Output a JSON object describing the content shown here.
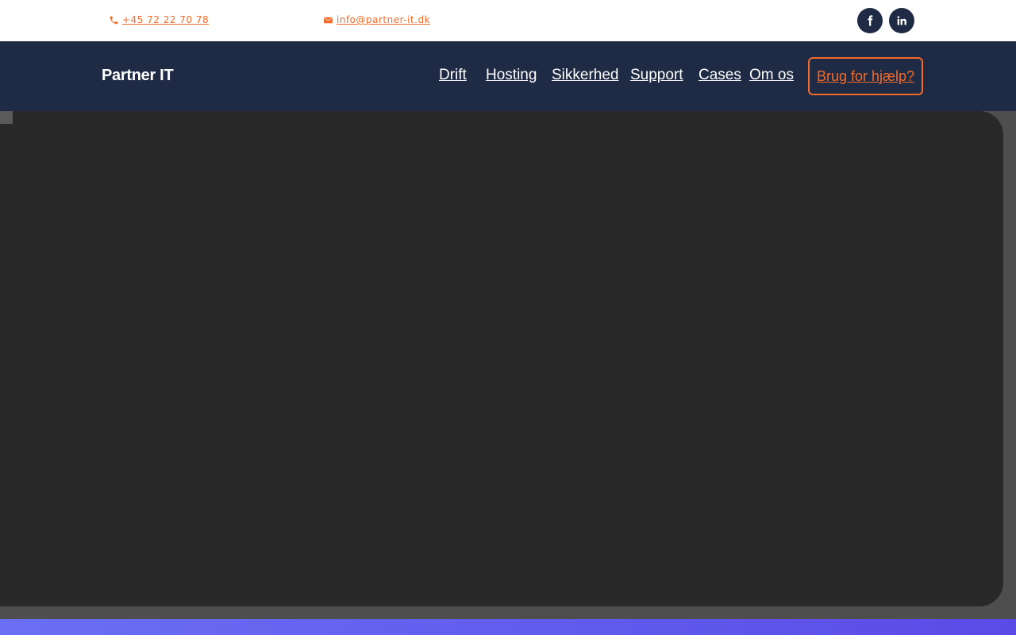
{
  "topbar": {
    "phone": "+45 72 22 70 78",
    "email": "info@partner-it.dk",
    "phone_icon": "phone-icon",
    "email_icon": "envelope-icon",
    "social": [
      {
        "icon": "facebook-icon",
        "glyph": "f"
      },
      {
        "icon": "linkedin-icon",
        "glyph": "in"
      }
    ]
  },
  "nav": {
    "logo": "Partner IT",
    "items": [
      "Drift",
      "Hosting",
      "Sikkerhed",
      "Support",
      "Cases",
      "Om os"
    ],
    "cta": "Brug for hjælp?"
  },
  "colors": {
    "navy": "#1f2a44",
    "accent": "#f26b2a",
    "hero": "#292929"
  }
}
